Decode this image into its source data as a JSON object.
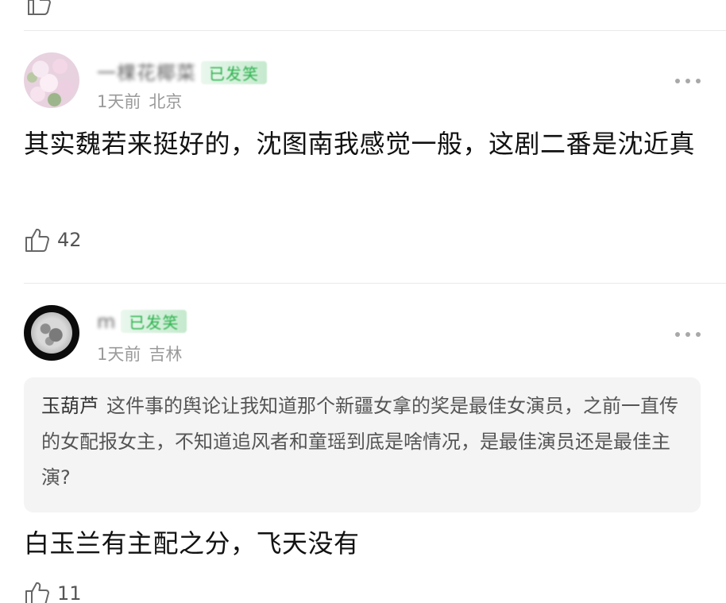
{
  "comments": [
    {
      "username": "一棵花椰菜",
      "badge": "已发笑",
      "time": "1天前",
      "location": "北京",
      "body": "其实魏若来挺好的，沈图南我感觉一般，这剧二番是沈近真",
      "likes": "42",
      "avatar": "flowers-avatar"
    },
    {
      "username": "m",
      "badge": "已发笑",
      "time": "1天前",
      "location": "吉林",
      "quote_author": "玉葫芦",
      "quote_text": "这件事的舆论让我知道那个新疆女拿的奖是最佳女演员，之前一直传的女配报女主，不知道追风者和童瑶到底是啥情况，是最佳演员还是最佳主演?",
      "body": "白玉兰有主配之分，飞天没有",
      "likes": "11",
      "avatar": "moon-avatar"
    }
  ],
  "icons": {
    "like": "thumbs-up-icon",
    "more": "more-dots-icon"
  },
  "colors": {
    "badge": "#2bb24c",
    "meta": "#9a9a9a",
    "quote_bg": "#f4f4f4"
  }
}
